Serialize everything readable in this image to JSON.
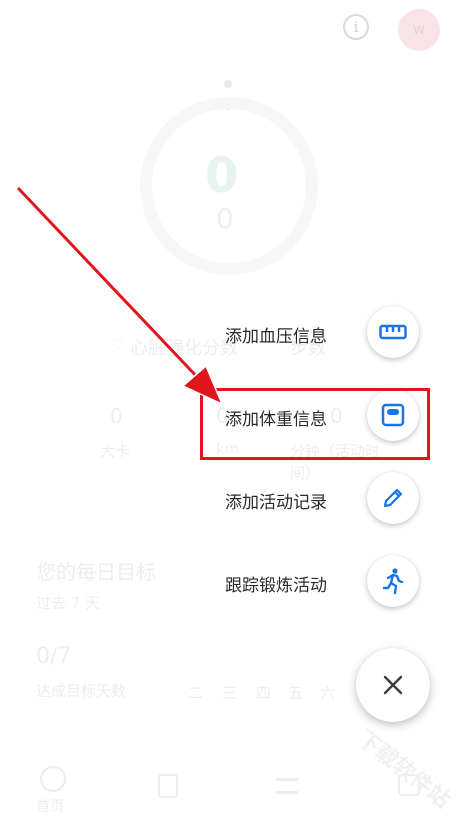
{
  "topbar": {
    "info_icon": "info-icon",
    "avatar_letter": "W"
  },
  "summary": {
    "big_number": "0",
    "small_number": "0"
  },
  "metrics": {
    "heart_label": "心脏强化分数",
    "steps_label": "步数",
    "calories_value": "0",
    "calories_unit": "大卡",
    "distance_value": "0",
    "distance_unit": "km",
    "minutes_value": "0",
    "minutes_unit": "分钟（活动时间）"
  },
  "goals": {
    "title": "您的每日目标",
    "subtitle": "过去 7 天",
    "value": "0/7",
    "caption": "达成目标天数",
    "weekdays": [
      "二",
      "三",
      "四",
      "五",
      "六"
    ]
  },
  "bottom_nav": {
    "home_label": "首页"
  },
  "menu": {
    "items": [
      {
        "label": "添加血压信息",
        "icon": "blood-pressure-icon"
      },
      {
        "label": "添加体重信息",
        "icon": "scale-icon"
      },
      {
        "label": "添加活动记录",
        "icon": "pencil-icon"
      },
      {
        "label": "跟踪锻炼活动",
        "icon": "running-icon"
      }
    ],
    "close_icon": "close-icon"
  },
  "watermark": "下载软件站",
  "colors": {
    "accent_blue": "#1a73e8",
    "highlight_red": "#e0161c"
  }
}
